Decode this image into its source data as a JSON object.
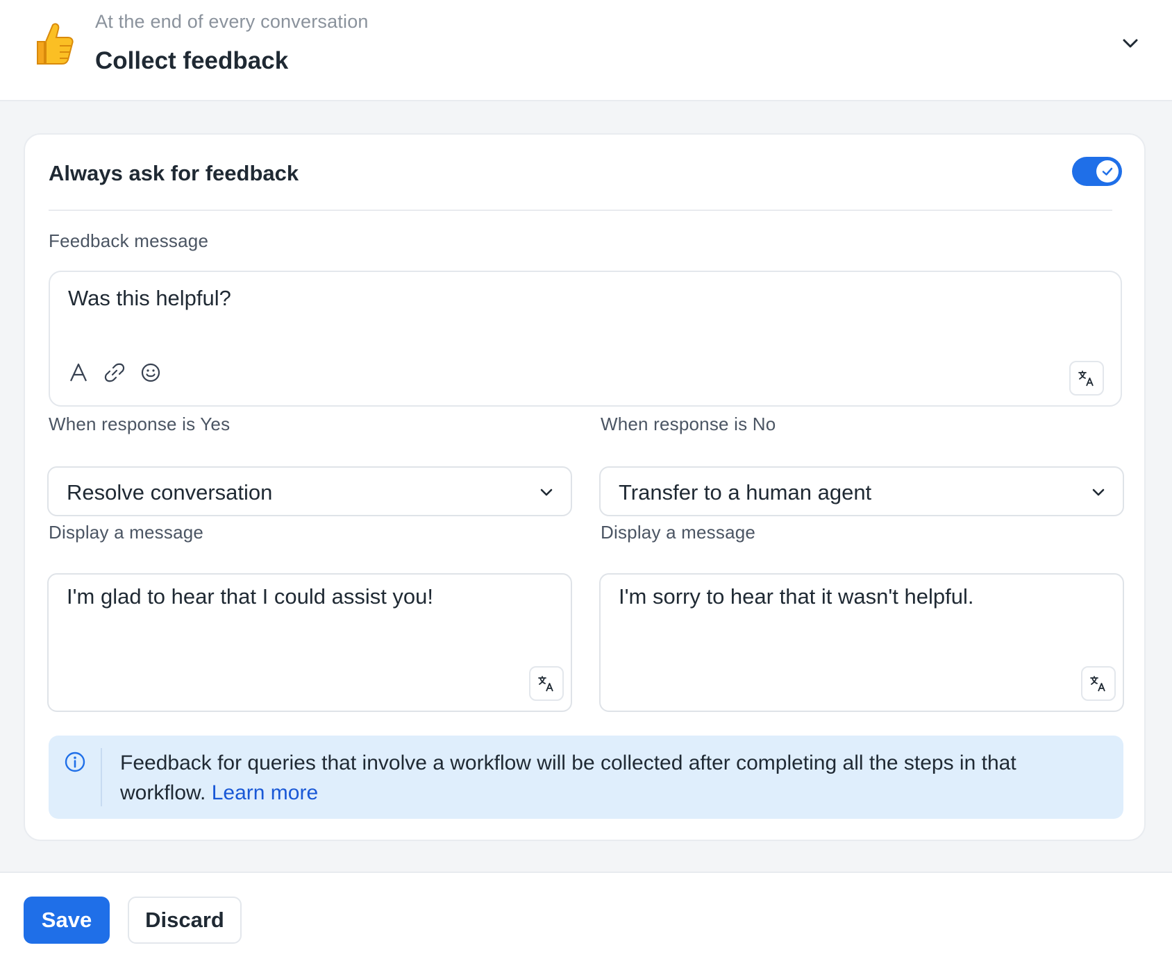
{
  "header": {
    "subtitle": "At the end of every conversation",
    "title": "Collect feedback",
    "icon": "thumbs-up-emoji"
  },
  "card": {
    "title": "Always ask for feedback",
    "toggle_on": true,
    "feedback_label": "Feedback message",
    "feedback_value": "Was this helpful?",
    "editor_tools": [
      "text-format-icon",
      "link-icon",
      "emoji-icon"
    ],
    "yes": {
      "label": "When response is Yes",
      "action": "Resolve conversation",
      "message_label": "Display a message",
      "message": "I'm glad to hear that I could assist you!"
    },
    "no": {
      "label": "When response is No",
      "action": "Transfer to a human agent",
      "message_label": "Display a message",
      "message": "I'm sorry to hear that it wasn't helpful."
    },
    "info": {
      "text": "Feedback for queries that involve a workflow will be collected after completing all the steps in that workflow. ",
      "link": "Learn more"
    }
  },
  "footer": {
    "save_label": "Save",
    "discard_label": "Discard"
  },
  "colors": {
    "accent": "#1f6fe8",
    "info_bg": "#dfeefc",
    "link": "#1958d6"
  }
}
